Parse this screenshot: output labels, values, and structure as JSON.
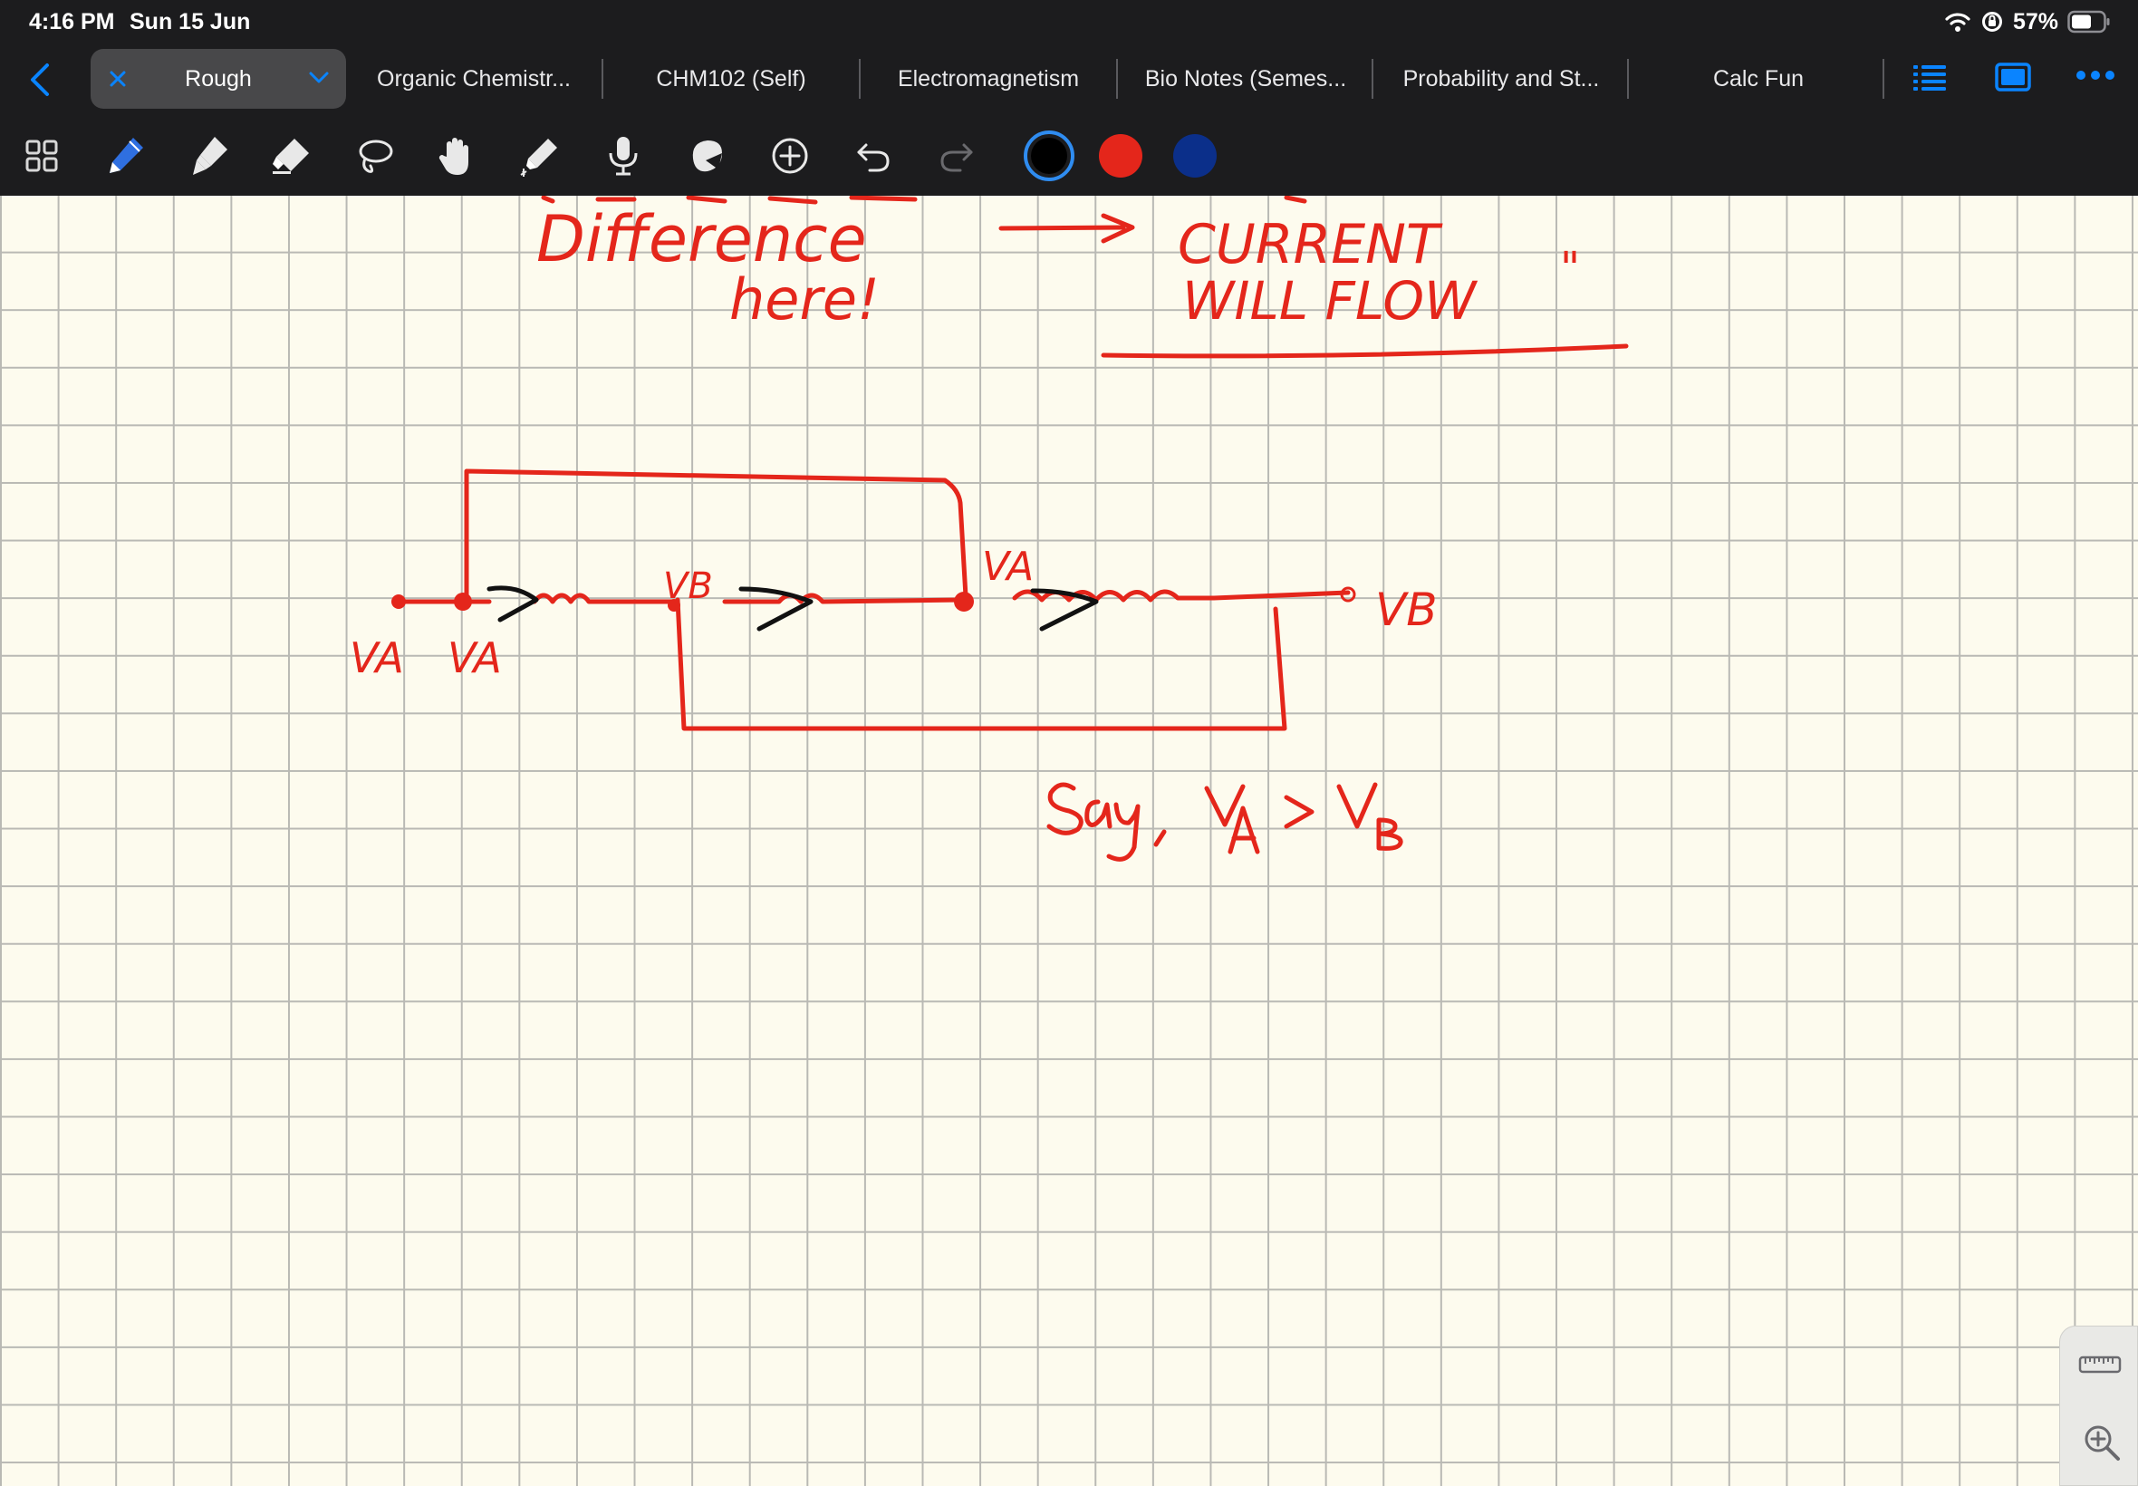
{
  "status": {
    "time": "4:16 PM",
    "date": "Sun 15 Jun",
    "battery": "57%"
  },
  "tabs": {
    "active": "Rough",
    "items": [
      "Organic Chemistr...",
      "CHM102 (Self)",
      "Electromagnetism",
      "Bio Notes (Semes...",
      "Probability and St...",
      "Calc Fun"
    ]
  },
  "toolbar": {
    "tools": [
      "thumbnails-icon",
      "pen-icon",
      "highlighter-icon",
      "eraser-icon",
      "lasso-icon",
      "hand-icon",
      "laser-pointer-icon",
      "microphone-icon",
      "shapes-icon",
      "add-icon",
      "undo-icon",
      "redo-icon"
    ],
    "colors": [
      "#000000",
      "#e4261b",
      "#0b2f8a"
    ]
  },
  "colors": {
    "accent": "#0a84ff",
    "ink_red": "#e4261b",
    "ink_black": "#111111",
    "paper": "#fdfbee"
  },
  "notes": {
    "top_line1": "Difference",
    "top_line2": "here!",
    "current_line1": "CURRENT",
    "current_line2": "WILL FLOW",
    "quote": "\"",
    "va_left1": "VA",
    "va_left2": "VA",
    "vb_mid": "VB",
    "va_mid": "VA",
    "vb_right": "VB",
    "say": "Say,",
    "relation": "VA > VB"
  }
}
